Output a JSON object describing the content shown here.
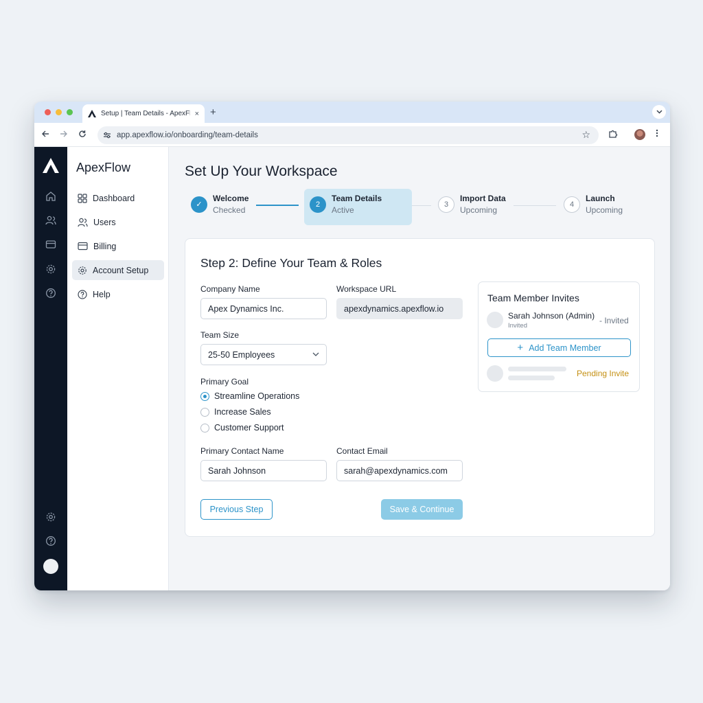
{
  "browser": {
    "tab_title": "Setup | Team Details - ApexFlow",
    "tab_close": "×",
    "new_tab": "+",
    "url": "app.apexflow.io/onboarding/team-details",
    "traffic_colors": [
      "#ee5f58",
      "#f6bd3c",
      "#5bc452"
    ]
  },
  "sidebar": {
    "brand": "ApexFlow",
    "items": [
      {
        "label": "Dashboard",
        "icon": "grid-icon"
      },
      {
        "label": "Users",
        "icon": "users-icon"
      },
      {
        "label": "Billing",
        "icon": "card-icon"
      },
      {
        "label": "Account Setup",
        "icon": "gear-icon",
        "active": true
      },
      {
        "label": "Help",
        "icon": "help-icon"
      }
    ]
  },
  "main": {
    "title": "Set Up Your Workspace",
    "steps": [
      {
        "title": "Welcome",
        "status": "Checked",
        "marker": "✓"
      },
      {
        "title": "Team Details",
        "status": "Active",
        "marker": "2"
      },
      {
        "title": "Import Data",
        "status": "Upcoming",
        "marker": "3"
      },
      {
        "title": "Launch",
        "status": "Upcoming",
        "marker": "4"
      }
    ]
  },
  "form": {
    "heading": "Step 2: Define Your Team & Roles",
    "company_label": "Company Name",
    "company_value": "Apex Dynamics Inc.",
    "workspace_label": "Workspace URL",
    "workspace_value": "apexdynamics.apexflow.io",
    "team_size_label": "Team Size",
    "team_size_value": "25-50 Employees",
    "goal_label": "Primary Goal",
    "goals": [
      {
        "label": "Streamline Operations",
        "checked": true
      },
      {
        "label": "Increase Sales",
        "checked": false
      },
      {
        "label": "Customer Support",
        "checked": false
      }
    ],
    "contact_name_label": "Primary Contact Name",
    "contact_name_value": "Sarah Johnson",
    "contact_email_label": "Contact Email",
    "contact_email_value": "sarah@apexdynamics.com",
    "prev_button": "Previous Step",
    "save_button": "Save & Continue"
  },
  "invites": {
    "title": "Team Member Invites",
    "member_name": "Sarah Johnson (Admin)",
    "member_sub": "Invited",
    "member_status": "- Invited",
    "add_button": "Add Team Member",
    "add_icon": "+",
    "pending_label": "Pending Invite"
  },
  "colors": {
    "accent": "#2c93c9",
    "rail": "#0d1726",
    "pending": "#c48f12"
  }
}
